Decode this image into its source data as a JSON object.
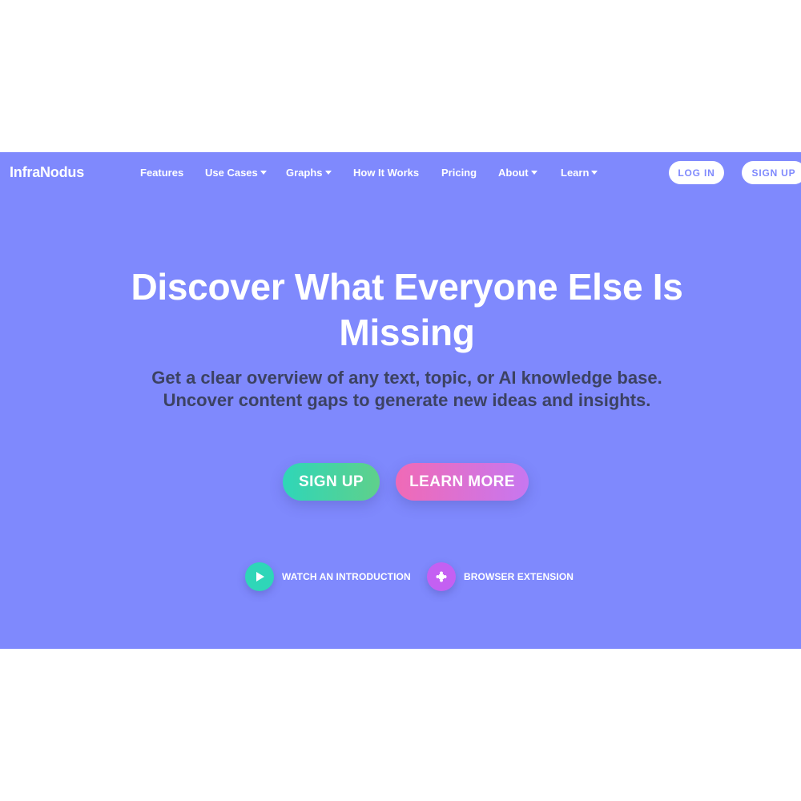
{
  "brand": {
    "name": "InfraNodus",
    "background": "#7f89fd"
  },
  "nav": {
    "items": [
      {
        "label": "Features",
        "dropdown": false
      },
      {
        "label": "Use Cases",
        "dropdown": true
      },
      {
        "label": "Graphs",
        "dropdown": true
      },
      {
        "label": "How It Works",
        "dropdown": false
      },
      {
        "label": "Pricing",
        "dropdown": false
      },
      {
        "label": "About",
        "dropdown": true
      },
      {
        "label": "Learn",
        "dropdown": true
      }
    ],
    "login_label": "LOG IN",
    "signup_label": "SIGN UP"
  },
  "hero": {
    "title_line1": "Discover What Everyone Else Is",
    "title_line2": "Missing",
    "subtitle_line1": "Get a clear overview of any text, topic, or AI knowledge base.",
    "subtitle_line2": "Uncover content gaps to generate new ideas and insights.",
    "signup_label": "SIGN UP",
    "learn_more_label": "LEARN MORE"
  },
  "links": {
    "intro_label": "WATCH AN INTRODUCTION",
    "intro_icon": "play-icon",
    "extension_label": "BROWSER EXTENSION",
    "extension_icon": "puzzle-icon"
  },
  "colors": {
    "signup_gradient": [
      "#2fd6b8",
      "#5fd08b"
    ],
    "learn_more_gradient": [
      "#f06ab6",
      "#c777f0"
    ],
    "subtitle_text": "#3c4262"
  }
}
